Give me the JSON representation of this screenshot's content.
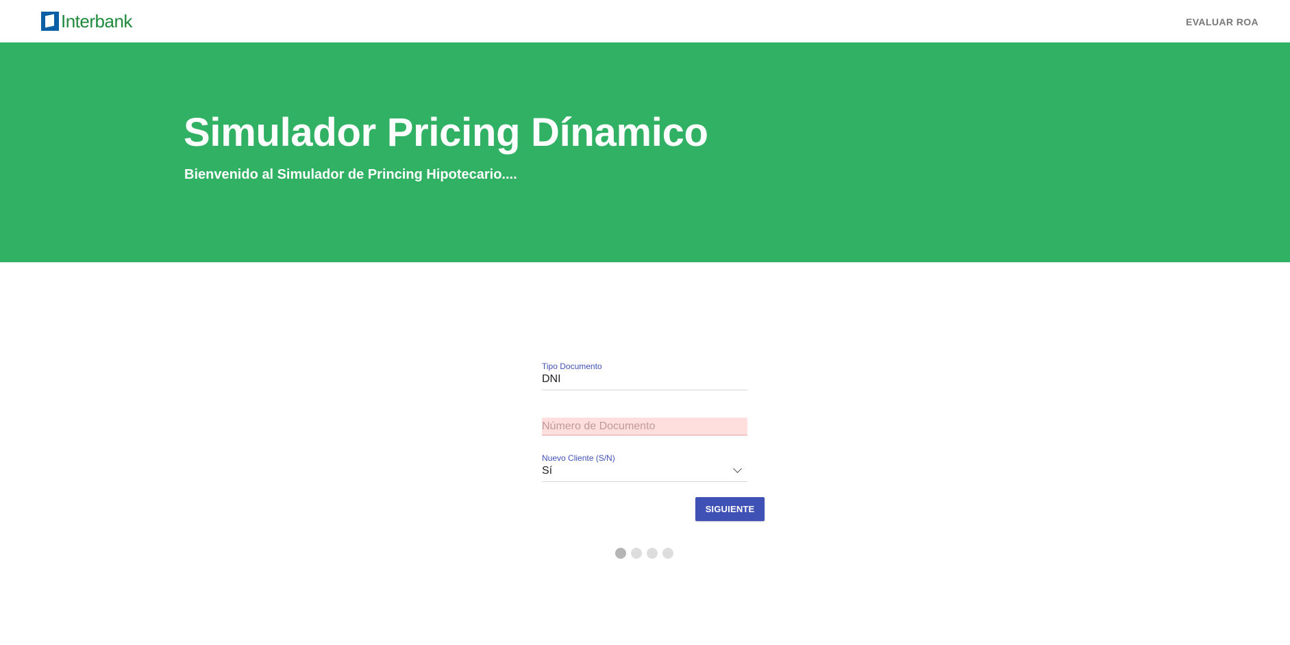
{
  "header": {
    "logo_text": "Interbank",
    "nav_link": "EVALUAR ROA"
  },
  "hero": {
    "title": "Simulador Pricing Dínamico",
    "subtitle": "Bienvenido al Simulador de Princing Hipotecario...."
  },
  "form": {
    "tipo_documento": {
      "label": "Tipo Documento",
      "value": "DNI"
    },
    "numero_documento": {
      "placeholder": "Número de Documento",
      "value": ""
    },
    "nuevo_cliente": {
      "label": "Nuevo Cliente (S/N)",
      "value": "Sí"
    },
    "next_button": "SIGUIENTE"
  },
  "stepper": {
    "total_steps": 4,
    "active_step": 1
  },
  "colors": {
    "brand_green": "#31b163",
    "logo_blue": "#0b5fa5",
    "primary": "#3f51b5",
    "error_bg": "#ffdede"
  }
}
